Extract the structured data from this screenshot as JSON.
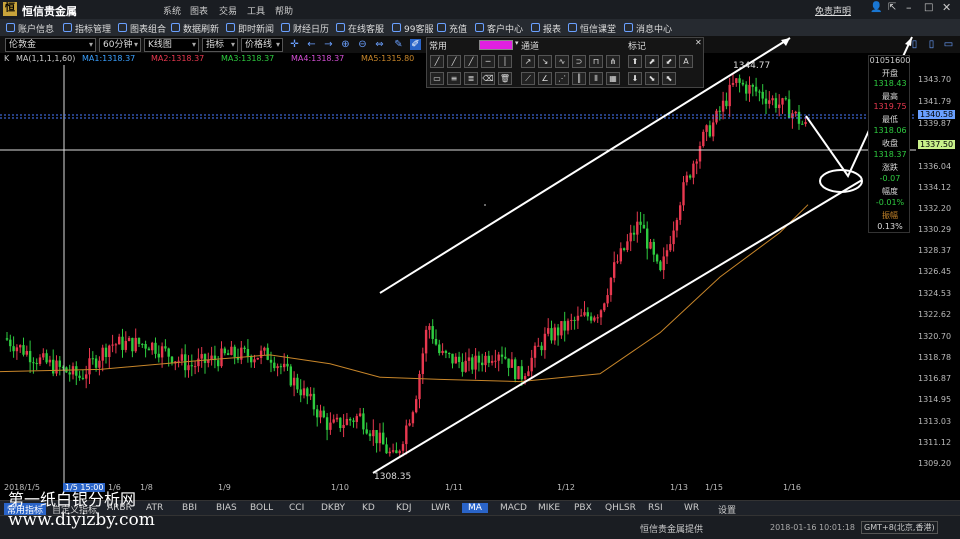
{
  "app": {
    "name": "恒信贵金属",
    "menus": [
      "系统",
      "图表",
      "交易",
      "工具",
      "帮助"
    ],
    "free_statement": "免责声明"
  },
  "toolbar": [
    "账户信息",
    "指标管理",
    "图表组合",
    "数据刷新",
    "即时新闻",
    "财经日历",
    "在线客服",
    "99客服",
    "充值",
    "客户中心",
    "报表",
    "恒信课堂",
    "消息中心"
  ],
  "controls": {
    "symbol": "伦敦金",
    "period": "60分钟",
    "chart_type": "K线图",
    "indicator": "指标",
    "line_type": "价格线"
  },
  "ma": {
    "k": "K",
    "label": "MA(1,1,1,1,60)",
    "ma1": "MA1:1318.37",
    "ma2": "MA2:1318.37",
    "ma3": "MA3:1318.37",
    "ma4": "MA4:1318.37",
    "ma5": "MA5:1315.80"
  },
  "draw_panel": {
    "common": "常用",
    "lines": "通道",
    "mark": "标记"
  },
  "info": {
    "time": "01051600",
    "open_label": "开盘",
    "open": "1318.43",
    "high_label": "最高",
    "high": "1319.75",
    "low_label": "最低",
    "low": "1318.06",
    "close_label": "收盘",
    "close": "1318.37",
    "chg_label": "涨跌",
    "chg": "-0.07",
    "pct_label": "幅度",
    "pct": "-0.01%",
    "amp_label": "振幅",
    "amp": "0.13%"
  },
  "price_axis": [
    "1343.70",
    "1341.79",
    "1339.87",
    "1336.04",
    "1334.12",
    "1332.20",
    "1330.29",
    "1328.37",
    "1326.45",
    "1324.53",
    "1322.62",
    "1320.70",
    "1318.78",
    "1316.87",
    "1314.95",
    "1313.03",
    "1311.12",
    "1309.20"
  ],
  "price_tags": {
    "blue": "1340.58",
    "green": "1337.50"
  },
  "labels": {
    "high": "1344.77",
    "low": "1308.35",
    "left_date": "2018/1/5",
    "cross_date": "1/5 15:00"
  },
  "x_axis": [
    "1/6",
    "1/8",
    "1/9",
    "1/10",
    "1/11",
    "1/12",
    "1/13",
    "1/15",
    "1/16"
  ],
  "tabs": [
    "常用指标",
    "自定义指标",
    "ARBR",
    "ATR",
    "BBI",
    "BIAS",
    "BOLL",
    "CCI",
    "DKBY",
    "KD",
    "KDJ",
    "LWR",
    "MA",
    "MACD",
    "MIKE",
    "PBX",
    "QHLSR",
    "RSI",
    "WR",
    "设置"
  ],
  "status": {
    "provider": "恒信贵金属提供",
    "datetime": "2018-01-16 10:01:18",
    "tz": "GMT+8(北京,香港)"
  },
  "watermark": {
    "line1": "第一纸白银分析网",
    "line2": "www.diyizby.com"
  },
  "colors": {
    "up": "#e8384f",
    "down": "#2ecc40",
    "ma60": "#c8862a",
    "bg": "#000000"
  },
  "chart_data": {
    "type": "candlestick",
    "series": [
      {
        "name": "MA5",
        "values": []
      }
    ],
    "ylim": [
      1308,
      1346
    ],
    "x": [
      "2018/1/5",
      "1/6",
      "1/8",
      "1/9",
      "1/10",
      "1/11",
      "1/12",
      "1/13",
      "1/15",
      "1/16"
    ],
    "high": 1344.77,
    "low": 1308.35,
    "last": 1340.58
  }
}
